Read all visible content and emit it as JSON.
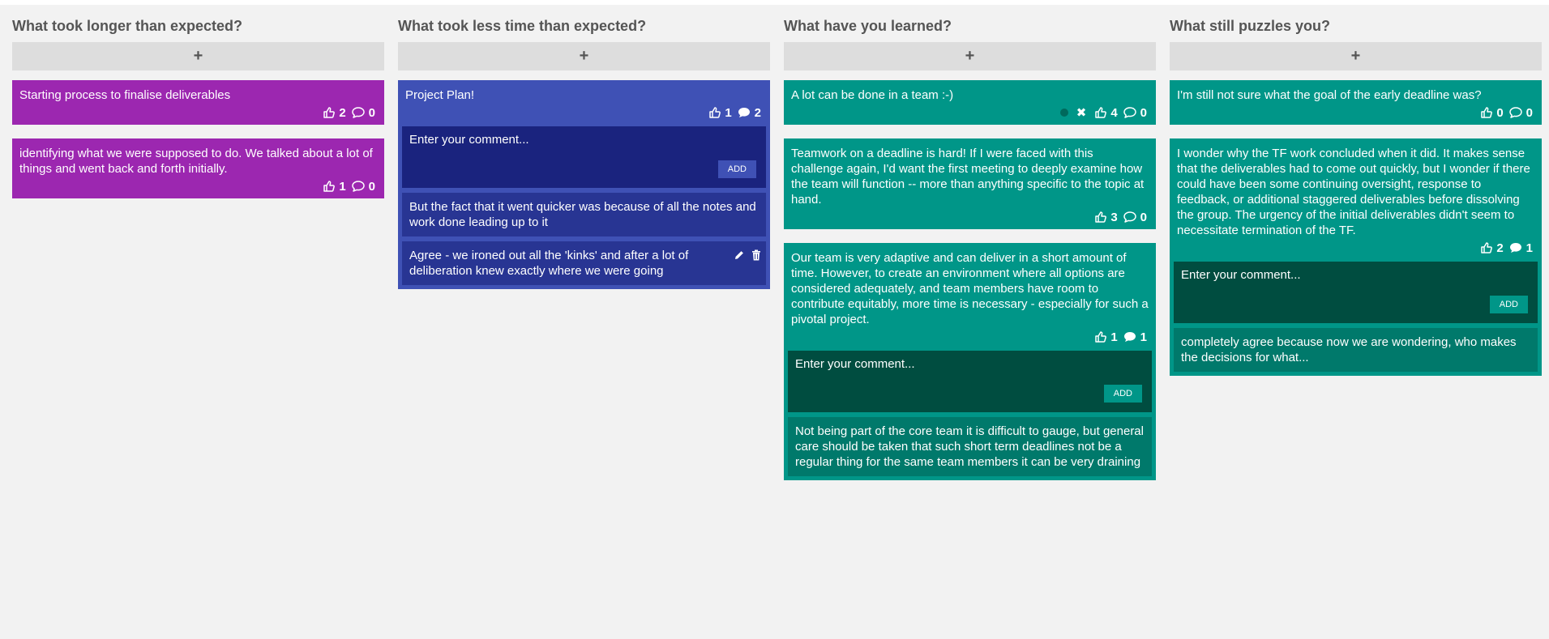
{
  "add_label": "+",
  "comment_placeholder": "Enter your comment...",
  "add_comment_label": "ADD",
  "colors": {
    "purple": "#9c27b0",
    "blue": "#3f51b5",
    "teal": "#009688",
    "background": "#f2f2f2"
  },
  "columns": [
    {
      "title": "What took longer than expected?",
      "cards": [
        {
          "text": "Starting process to finalise deliverables",
          "likes": "2",
          "comments": "0"
        },
        {
          "text": "identifying what we were supposed to do. We talked about a lot of things and went back and forth initially.",
          "likes": "1",
          "comments": "0"
        }
      ]
    },
    {
      "title": "What took less time than expected?",
      "cards": [
        {
          "text": "Project Plan!",
          "likes": "1",
          "comments": "2",
          "thread": [
            "But the fact that it went quicker was because of all the notes and work done leading up to it",
            "Agree - we ironed out all the 'kinks' and after a lot of deliberation knew exactly where we were going"
          ]
        }
      ]
    },
    {
      "title": "What have you learned?",
      "cards": [
        {
          "text": "A lot can be done in a team :-)",
          "likes": "4",
          "comments": "0"
        },
        {
          "text": "Teamwork on a deadline is hard! If I were faced with this challenge again, I'd want the first meeting to deeply examine how the team will function -- more than anything specific to the topic at hand.",
          "likes": "3",
          "comments": "0"
        },
        {
          "text": "Our team is very adaptive and can deliver in a short amount of time. However, to create an environment where all options are considered adequately, and team members have room to contribute equitably, more time is necessary - especially for such a pivotal project.",
          "likes": "1",
          "comments": "1",
          "thread": [
            "Not being part of the core team it is difficult to gauge, but general care should be taken that such short term deadlines not be a regular thing for the same team members it can be very draining"
          ]
        }
      ]
    },
    {
      "title": "What still puzzles you?",
      "cards": [
        {
          "text": "I'm still not sure what the goal of the early deadline was?",
          "likes": "0",
          "comments": "0"
        },
        {
          "text": "I wonder why the TF work concluded when it did. It makes sense that the deliverables had to come out quickly, but I wonder if there could have been some continuing oversight, response to feedback, or additional staggered deliverables before dissolving the group. The urgency of the initial deliverables didn't seem to necessitate termination of the TF.",
          "likes": "2",
          "comments": "1",
          "thread": [
            "completely agree because now we are wondering, who makes the decisions for what..."
          ]
        }
      ]
    }
  ]
}
